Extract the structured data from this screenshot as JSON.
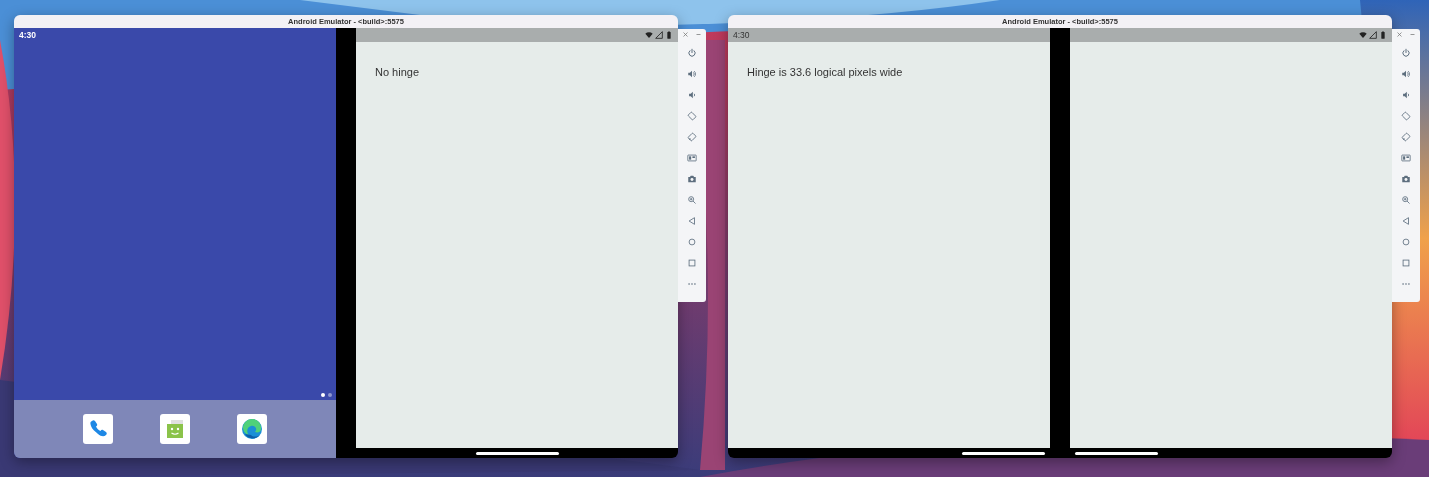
{
  "windows": [
    {
      "title": "Android Emulator - <build>:5575",
      "screens": [
        {
          "kind": "home",
          "time": "4:30",
          "page_dots": [
            {
              "selected": true
            },
            {
              "selected": false
            }
          ],
          "dock": [
            {
              "kind": "phone"
            },
            {
              "kind": "bag"
            },
            {
              "kind": "swirl"
            }
          ]
        },
        {
          "kind": "app",
          "message": "No hinge"
        }
      ]
    },
    {
      "title": "Android Emulator - <build>:5575",
      "screens": [
        {
          "kind": "app",
          "time": "4:30",
          "message": "Hinge is 33.6 logical pixels wide"
        },
        {
          "kind": "app"
        }
      ]
    }
  ]
}
